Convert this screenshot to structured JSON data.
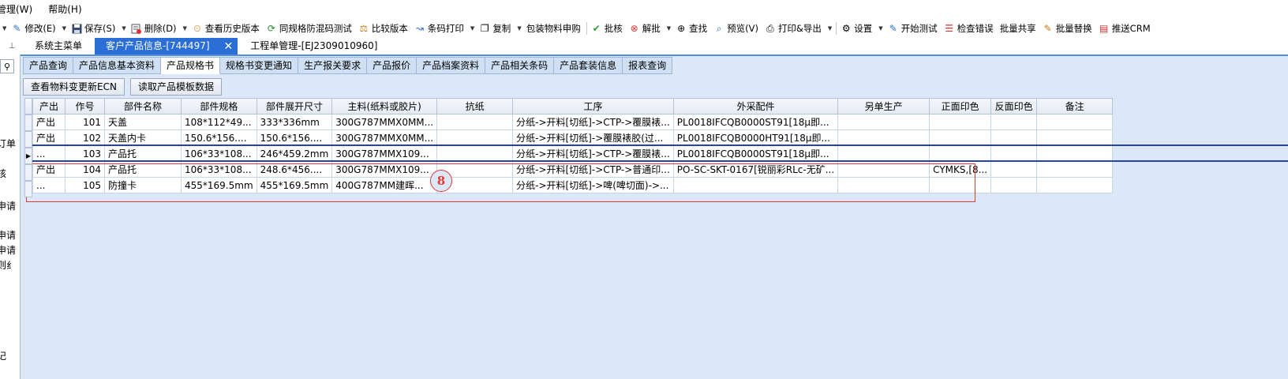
{
  "menubar": {
    "items": [
      "管理(W)",
      "帮助(H)"
    ]
  },
  "toolbar": {
    "modify": "修改(E)",
    "save": "保存(S)",
    "delete": "删除(D)",
    "history": "查看历史版本",
    "anti_confusion": "同规格防混码测试",
    "compare": "比较版本",
    "barcode_print": "条码打印",
    "copy": "复制",
    "packing_purchase": "包装物料申购",
    "approve": "批核",
    "unapprove": "解批",
    "find": "查找",
    "preview": "预览(V)",
    "print_export": "打印&导出",
    "settings": "设置",
    "start_test": "开始测试",
    "check_errors": "检查错误",
    "batch_share": "批量共享",
    "batch_replace": "批量替换",
    "push_crm": "推送CRM"
  },
  "doc_tabs": {
    "main_menu": "系统主菜单",
    "customer_product": "客户产品信息-[744497]",
    "work_order": "工程单管理-[EJ2309010960]"
  },
  "sidebar": {
    "fragments": [
      "订单",
      "核",
      "申请",
      "申请",
      "申请",
      "则纟",
      "记"
    ]
  },
  "sub_tabs": {
    "items": [
      "产品查询",
      "产品信息基本资料",
      "产品规格书",
      "规格书变更通知",
      "生产报关要求",
      "产品报价",
      "产品档案资料",
      "产品相关条码",
      "产品套装信息",
      "报表查询"
    ]
  },
  "actions": {
    "ecn": "查看物料变更新ECN",
    "read_template": "读取产品模板数据"
  },
  "grid": {
    "headers": [
      "产出",
      "作号",
      "部件名称",
      "部件规格",
      "部件展开尺寸",
      "主料(纸料或胶片)",
      "抗纸",
      "工序",
      "外采配件",
      "另单生产",
      "正面印色",
      "反面印色",
      "备注"
    ],
    "rows": [
      [
        "产出",
        "101",
        "天盖",
        "108*112*49...",
        "333*336mm",
        "300G787MMX0MM...",
        "",
        "分纸->开料[切纸]->CTP->覆膜裱...",
        "PL0018IFCQB0000ST91[18μ即...",
        "",
        "",
        "",
        ""
      ],
      [
        "产出",
        "102",
        "天盖内卡",
        "150.6*156....",
        "150.6*156....",
        "300G787MMX0MM...",
        "",
        "分纸->开料[切纸]->覆膜裱胶(过...",
        "PL0018IFCQB0000HT91[18μ即...",
        "",
        "",
        "",
        ""
      ],
      [
        "...",
        "103",
        "产品托",
        "106*33*108...",
        "246*459.2mm",
        "300G787MMX109...",
        "",
        "分纸->开料[切纸]->CTP->覆膜裱...",
        "PL0018IFCQB0000ST91[18μ即...",
        "",
        "",
        "",
        ""
      ],
      [
        "产出",
        "104",
        "产品托",
        "106*33*108...",
        "248.6*456....",
        "300G787MMX109...",
        "",
        "分纸->开料[切纸]->CTP->普通印...",
        "PO-SC-SKT-0167[锐丽彩RLc-无矿...",
        "",
        "CYMKS,[8...",
        "",
        ""
      ],
      [
        "...",
        "105",
        "防撞卡",
        "455*169.5mm",
        "455*169.5mm",
        "400G787MM建晖...",
        "",
        "分纸->开料[切纸]->啤(啤切面)->...",
        "",
        "",
        "",
        "",
        ""
      ]
    ]
  },
  "annotation": {
    "marker": "8",
    "color": "#e53935"
  },
  "colors": {
    "active_tab": "#2b6fd6",
    "panel_bg": "#dce8f7",
    "current_row_line": "#2742a8"
  }
}
